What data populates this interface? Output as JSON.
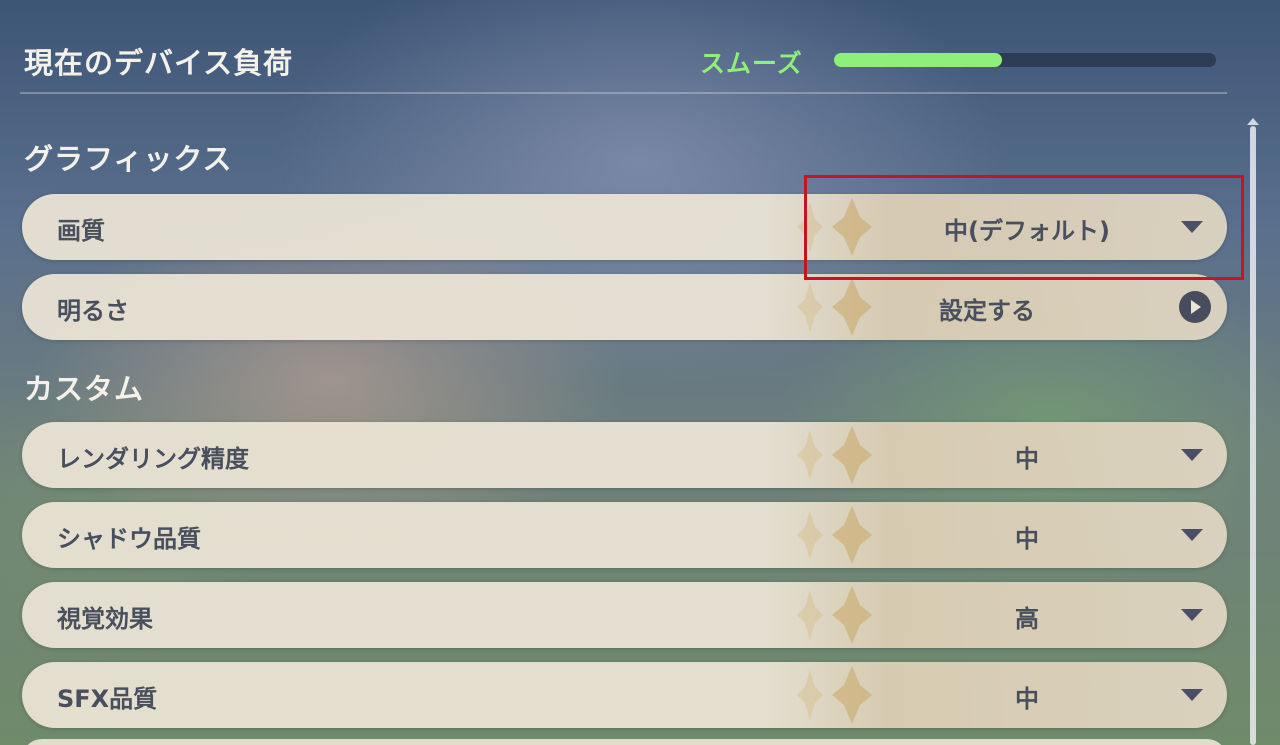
{
  "header": {
    "title": "現在のデバイス負荷",
    "load_status": "スムーズ",
    "load_level": 0.44,
    "status_color": "#8ef07a"
  },
  "sections": {
    "graphics": "グラフィックス",
    "custom": "カスタム"
  },
  "settings": [
    {
      "label": "画質",
      "value": "中(デフォルト)",
      "control": "dropdown"
    },
    {
      "label": "明るさ",
      "value": "設定する",
      "control": "arrow-button"
    },
    {
      "label": "レンダリング精度",
      "value": "中",
      "control": "dropdown"
    },
    {
      "label": "シャドウ品質",
      "value": "中",
      "control": "dropdown"
    },
    {
      "label": "視覚効果",
      "value": "高",
      "control": "dropdown"
    },
    {
      "label": "SFX品質",
      "value": "中",
      "control": "dropdown"
    }
  ],
  "icons": {
    "dropdown": "chevron-down-icon",
    "arrow_button": "arrow-right-circle-icon",
    "row_decoration": "four-point-star-icon"
  },
  "colors": {
    "highlight": "#c8141e"
  }
}
